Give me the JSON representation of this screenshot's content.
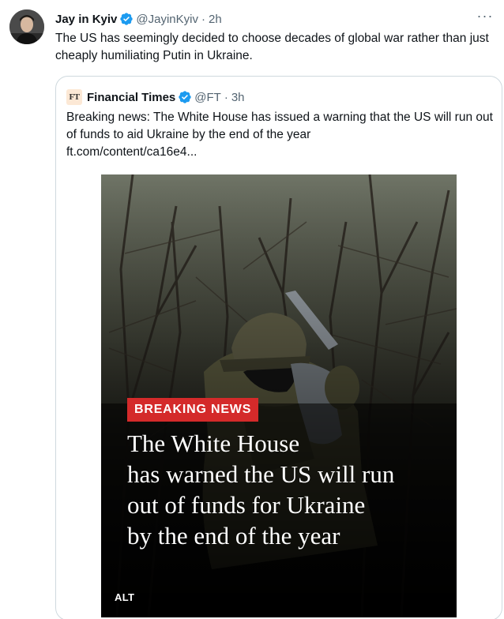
{
  "tweet": {
    "author_name": "Jay in Kyiv",
    "author_handle": "@JayinKyiv",
    "separator": "·",
    "time": "2h",
    "text": "The US has seemingly decided to choose decades of global war rather than just cheaply humiliating Putin in Ukraine.",
    "more_label": "···"
  },
  "quote": {
    "logo_text": "FT",
    "author_name": "Financial Times",
    "author_handle": "@FT",
    "separator": "·",
    "time": "3h",
    "text": "Breaking news: The White House has issued a warning that the US will run out of funds to aid Ukraine by the end of the year",
    "link": "ft.com/content/ca16e4...",
    "media": {
      "badge": "BREAKING NEWS",
      "headline_lines": [
        "The White House",
        "has warned the US will run",
        "out of funds for Ukraine",
        "by the end of the year"
      ],
      "alt_label": "ALT"
    }
  },
  "colors": {
    "text_primary": "#0f1419",
    "text_secondary": "#536471",
    "verified_blue": "#1d9bf0",
    "border": "#cfd9de",
    "breaking_red": "#d42a2a",
    "ft_pink": "#fce8d5"
  },
  "icons": {
    "verified": "verified-badge-icon",
    "more": "more-options-icon"
  }
}
